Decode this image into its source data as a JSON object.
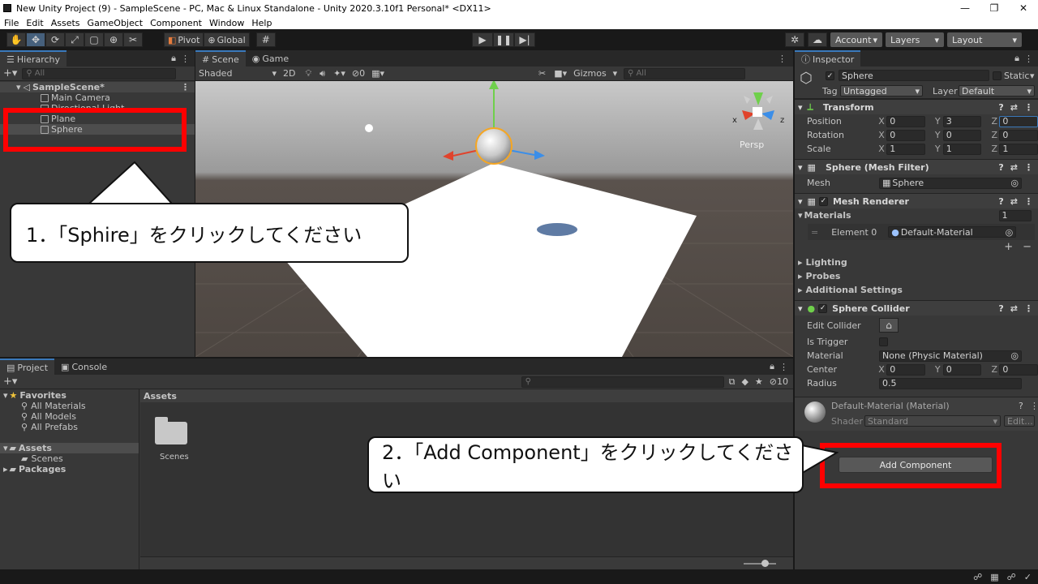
{
  "window": {
    "title": "New Unity Project (9) - SampleScene - PC, Mac & Linux Standalone - Unity 2020.3.10f1 Personal* <DX11>",
    "minimize": "—",
    "maximize": "❐",
    "close": "✕"
  },
  "menu": [
    "File",
    "Edit",
    "Assets",
    "GameObject",
    "Component",
    "Window",
    "Help"
  ],
  "toolbar": {
    "pivot": "Pivot",
    "global": "Global",
    "account": "Account",
    "layers": "Layers",
    "layout": "Layout"
  },
  "hierarchy": {
    "tab": "Hierarchy",
    "search_placeholder": "All",
    "scene": "SampleScene*",
    "items": [
      "Main Camera",
      "Directional Light",
      "Plane",
      "Sphere"
    ]
  },
  "scene": {
    "tabs": [
      "Scene",
      "Game"
    ],
    "shading": "Shaded",
    "mode2d": "2D",
    "hidden_count": "0",
    "gizmos": "Gizmos",
    "search_placeholder": "All",
    "persp": "Persp",
    "axis_x": "x",
    "axis_z": "z"
  },
  "inspector": {
    "tab": "Inspector",
    "object_name": "Sphere",
    "static_label": "Static",
    "tag_label": "Tag",
    "tag_value": "Untagged",
    "layer_label": "Layer",
    "layer_value": "Default",
    "transform": {
      "title": "Transform",
      "rows": [
        {
          "label": "Position",
          "x": "0",
          "y": "3",
          "z": "0"
        },
        {
          "label": "Rotation",
          "x": "0",
          "y": "0",
          "z": "0"
        },
        {
          "label": "Scale",
          "x": "1",
          "y": "1",
          "z": "1"
        }
      ]
    },
    "mesh_filter": {
      "title": "Sphere (Mesh Filter)",
      "mesh_label": "Mesh",
      "mesh_value": "Sphere"
    },
    "mesh_renderer": {
      "title": "Mesh Renderer",
      "materials_label": "Materials",
      "materials_count": "1",
      "element_label": "Element 0",
      "element_value": "Default-Material"
    },
    "foldouts": [
      "Lighting",
      "Probes",
      "Additional Settings"
    ],
    "collider": {
      "title": "Sphere Collider",
      "edit_label": "Edit Collider",
      "trigger_label": "Is Trigger",
      "material_label": "Material",
      "material_value": "None (Physic Material)",
      "center_label": "Center",
      "center": {
        "x": "0",
        "y": "0",
        "z": "0"
      },
      "radius_label": "Radius",
      "radius_value": "0.5"
    },
    "material": {
      "title": "Default-Material (Material)",
      "shader_label": "Shader",
      "shader_value": "Standard",
      "edit": "Edit..."
    },
    "add_component": "Add Component"
  },
  "project": {
    "tabs": [
      "Project",
      "Console"
    ],
    "favorites": "Favorites",
    "fav_items": [
      "All Materials",
      "All Models",
      "All Prefabs"
    ],
    "assets": "Assets",
    "asset_children": [
      "Scenes"
    ],
    "packages": "Packages",
    "breadcrumb": "Assets",
    "folder_label": "Scenes",
    "hidden_count": "10"
  },
  "callouts": {
    "one": "1．「Sphire」をクリックしてください",
    "two": "2．「Add Component」をクリックしてください"
  },
  "colors": {
    "accent": "#3a79bb",
    "callout_border": "#ff0000"
  }
}
